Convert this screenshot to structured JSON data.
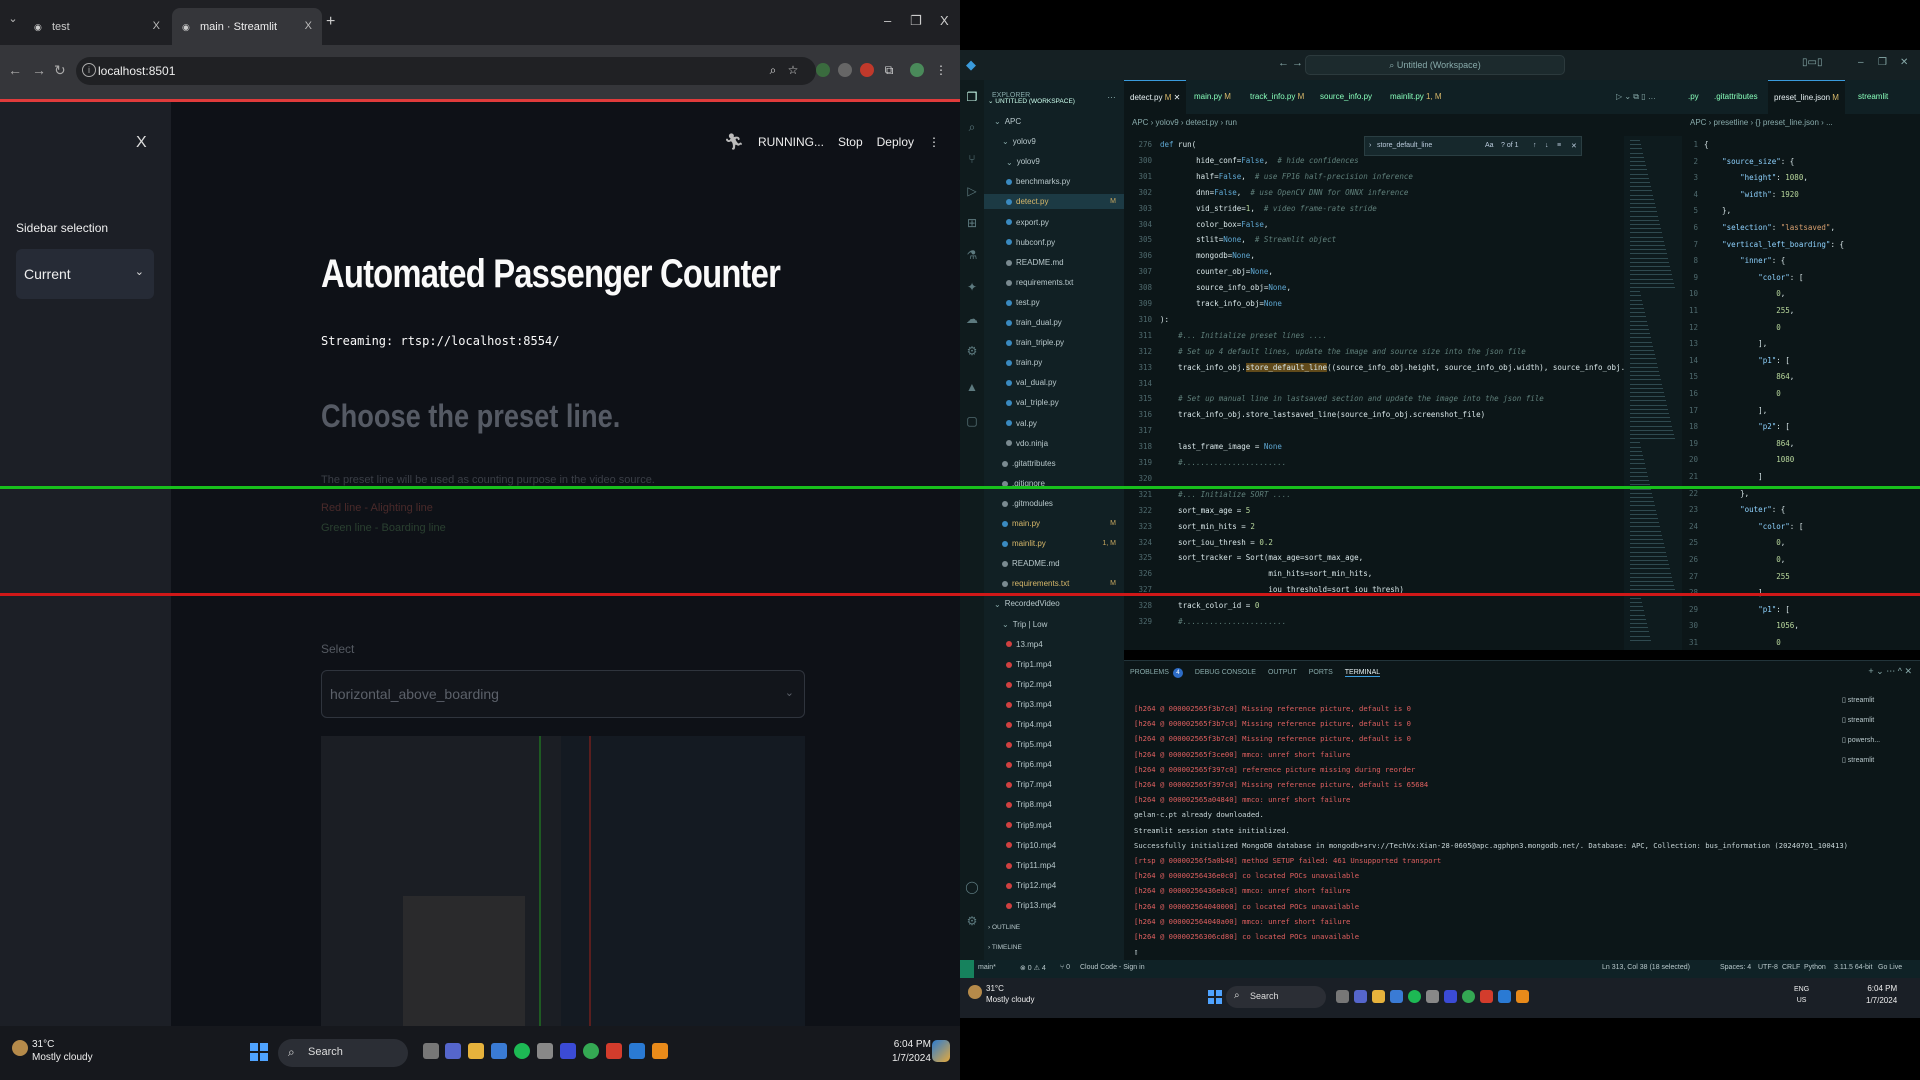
{
  "browser": {
    "tabs": [
      {
        "title": "test",
        "close": "X"
      },
      {
        "title": "main · Streamlit",
        "close": "X"
      }
    ],
    "new_tab": "+",
    "window_controls": {
      "minimize": "–",
      "restore": "❐",
      "close": "X"
    },
    "url": "localhost:8501"
  },
  "streamlit": {
    "sidebar": {
      "close": "X",
      "label": "Sidebar selection",
      "selected": "Current"
    },
    "header": {
      "status": "RUNNING...",
      "stop": "Stop",
      "deploy": "Deploy",
      "menu": "⋮"
    },
    "title": "Automated Passenger Counter",
    "streaming": "Streaming: rtsp://localhost:8554/",
    "subheader": "Choose the preset line.",
    "description": "The preset line will be used as counting purpose in the video source.",
    "red_line_text": "Red line - Alighting line",
    "green_line_text": "Green line - Boarding line",
    "select_label": "Select",
    "select_value": "horizontal_above_boarding"
  },
  "taskbar_left": {
    "temp": "31°C",
    "weather": "Mostly cloudy",
    "search": "Search",
    "time": "6:04 PM",
    "date": "1/7/2024"
  },
  "vscode": {
    "window_title": "Untitled (Workspace)",
    "explorer": {
      "header": "EXPLORER",
      "workspace": "UNTITLED (WORKSPACE)",
      "items": [
        {
          "name": "APC",
          "status": ""
        },
        {
          "name": "yolov9",
          "status": ""
        },
        {
          "name": "yolov9",
          "status": ""
        },
        {
          "name": "benchmarks.py",
          "status": ""
        },
        {
          "name": "detect.py",
          "status": "M"
        },
        {
          "name": "export.py",
          "status": ""
        },
        {
          "name": "hubconf.py",
          "status": ""
        },
        {
          "name": "README.md",
          "status": ""
        },
        {
          "name": "requirements.txt",
          "status": ""
        },
        {
          "name": "test.py",
          "status": ""
        },
        {
          "name": "train_dual.py",
          "status": ""
        },
        {
          "name": "train_triple.py",
          "status": ""
        },
        {
          "name": "train.py",
          "status": ""
        },
        {
          "name": "val_dual.py",
          "status": ""
        },
        {
          "name": "val_triple.py",
          "status": ""
        },
        {
          "name": "val.py",
          "status": ""
        },
        {
          "name": "vdo.ninja",
          "status": ""
        },
        {
          "name": ".gitattributes",
          "status": ""
        },
        {
          "name": ".gitignore",
          "status": ""
        },
        {
          "name": ".gitmodules",
          "status": ""
        },
        {
          "name": "main.py",
          "status": "M"
        },
        {
          "name": "mainlit.py",
          "status": "1, M"
        },
        {
          "name": "README.md",
          "status": ""
        },
        {
          "name": "requirements.txt",
          "status": "M"
        },
        {
          "name": "RecordedVideo",
          "status": ""
        },
        {
          "name": "Trip | Low",
          "status": ""
        },
        {
          "name": "13.mp4",
          "status": ""
        },
        {
          "name": "Trip1.mp4",
          "status": ""
        },
        {
          "name": "Trip2.mp4",
          "status": ""
        },
        {
          "name": "Trip3.mp4",
          "status": ""
        },
        {
          "name": "Trip4.mp4",
          "status": ""
        },
        {
          "name": "Trip5.mp4",
          "status": ""
        },
        {
          "name": "Trip6.mp4",
          "status": ""
        },
        {
          "name": "Trip7.mp4",
          "status": ""
        },
        {
          "name": "Trip8.mp4",
          "status": ""
        },
        {
          "name": "Trip9.mp4",
          "status": ""
        },
        {
          "name": "Trip10.mp4",
          "status": ""
        },
        {
          "name": "Trip11.mp4",
          "status": ""
        },
        {
          "name": "Trip12.mp4",
          "status": ""
        },
        {
          "name": "Trip13.mp4",
          "status": ""
        }
      ],
      "outline": "OUTLINE",
      "timeline": "TIMELINE"
    },
    "editor_tabs": [
      {
        "name": "detect.py",
        "mark": "M"
      },
      {
        "name": "main.py",
        "mark": "M"
      },
      {
        "name": "track_info.py",
        "mark": "M"
      },
      {
        "name": "source_info.py",
        "mark": ""
      },
      {
        "name": "mainlit.py",
        "mark": "1, M"
      }
    ],
    "breadcrumb": "APC › yolov9 › detect.py › run",
    "find": {
      "query": "store_default_line",
      "count": "? of 1"
    },
    "code_lines": [
      {
        "n": "276",
        "t": "def run("
      },
      {
        "n": "300",
        "t": "        hide_conf=False,  # hide confidences"
      },
      {
        "n": "301",
        "t": "        half=False,  # use FP16 half-precision inference"
      },
      {
        "n": "302",
        "t": "        dnn=False,  # use OpenCV DNN for ONNX inference"
      },
      {
        "n": "303",
        "t": "        vid_stride=1,  # video frame-rate stride"
      },
      {
        "n": "304",
        "t": "        color_box=False,"
      },
      {
        "n": "305",
        "t": "        stlit=None,  # Streamlit object"
      },
      {
        "n": "306",
        "t": "        mongodb=None,"
      },
      {
        "n": "307",
        "t": "        counter_obj=None,"
      },
      {
        "n": "308",
        "t": "        source_info_obj=None,"
      },
      {
        "n": "309",
        "t": "        track_info_obj=None"
      },
      {
        "n": "310",
        "t": "):"
      },
      {
        "n": "311",
        "t": "    #... Initialize preset lines ...."
      },
      {
        "n": "312",
        "t": "    # Set up 4 default lines, update the image and source size into the json file"
      },
      {
        "n": "313",
        "t": "    track_info_obj.store_default_line((source_info_obj.height, source_info_obj.width), source_info_obj.screenshot_file)"
      },
      {
        "n": "314",
        "t": ""
      },
      {
        "n": "315",
        "t": "    # Set up manual line in lastsaved section and update the image into the json file"
      },
      {
        "n": "316",
        "t": "    track_info_obj.store_lastsaved_line(source_info_obj.screenshot_file)"
      },
      {
        "n": "317",
        "t": ""
      },
      {
        "n": "318",
        "t": "    last_frame_image = None"
      },
      {
        "n": "319",
        "t": "    #......................."
      },
      {
        "n": "320",
        "t": ""
      },
      {
        "n": "321",
        "t": "    #... Initialize SORT ...."
      },
      {
        "n": "322",
        "t": "    sort_max_age = 5"
      },
      {
        "n": "323",
        "t": "    sort_min_hits = 2"
      },
      {
        "n": "324",
        "t": "    sort_iou_thresh = 0.2"
      },
      {
        "n": "325",
        "t": "    sort_tracker = Sort(max_age=sort_max_age,"
      },
      {
        "n": "326",
        "t": "                        min_hits=sort_min_hits,"
      },
      {
        "n": "327",
        "t": "                        iou_threshold=sort_iou_thresh)"
      },
      {
        "n": "328",
        "t": "    track_color_id = 0"
      },
      {
        "n": "329",
        "t": "    #......................."
      }
    ],
    "editor2_tabs": [
      {
        "name": ".py"
      },
      {
        "name": ".gitattributes"
      },
      {
        "name": "preset_line.json",
        "mark": "M"
      },
      {
        "name": "streamlit"
      }
    ],
    "editor2_breadcrumb": "APC › presetline › {} preset_line.json › ...",
    "json_lines": [
      {
        "n": "1",
        "t": "{"
      },
      {
        "n": "2",
        "t": "    \"source_size\": {"
      },
      {
        "n": "3",
        "t": "        \"height\": 1080,"
      },
      {
        "n": "4",
        "t": "        \"width\": 1920"
      },
      {
        "n": "5",
        "t": "    },"
      },
      {
        "n": "6",
        "t": "    \"selection\": \"lastsaved\","
      },
      {
        "n": "7",
        "t": "    \"vertical_left_boarding\": {"
      },
      {
        "n": "8",
        "t": "        \"inner\": {"
      },
      {
        "n": "9",
        "t": "            \"color\": ["
      },
      {
        "n": "10",
        "t": "                0,"
      },
      {
        "n": "11",
        "t": "                255,"
      },
      {
        "n": "12",
        "t": "                0"
      },
      {
        "n": "13",
        "t": "            ],"
      },
      {
        "n": "14",
        "t": "            \"p1\": ["
      },
      {
        "n": "15",
        "t": "                864,"
      },
      {
        "n": "16",
        "t": "                0"
      },
      {
        "n": "17",
        "t": "            ],"
      },
      {
        "n": "18",
        "t": "            \"p2\": ["
      },
      {
        "n": "19",
        "t": "                864,"
      },
      {
        "n": "20",
        "t": "                1080"
      },
      {
        "n": "21",
        "t": "            ]"
      },
      {
        "n": "22",
        "t": "        },"
      },
      {
        "n": "23",
        "t": "        \"outer\": {"
      },
      {
        "n": "24",
        "t": "            \"color\": ["
      },
      {
        "n": "25",
        "t": "                0,"
      },
      {
        "n": "26",
        "t": "                0,"
      },
      {
        "n": "27",
        "t": "                255"
      },
      {
        "n": "28",
        "t": "            ],"
      },
      {
        "n": "29",
        "t": "            \"p1\": ["
      },
      {
        "n": "30",
        "t": "                1056,"
      },
      {
        "n": "31",
        "t": "                0"
      }
    ],
    "panel": {
      "tabs": [
        "PROBLEMS",
        "DEBUG CONSOLE",
        "OUTPUT",
        "PORTS",
        "TERMINAL"
      ],
      "problems_count": "4",
      "terminals": [
        "streamlit",
        "streamlit",
        "powersh...",
        "streamlit"
      ],
      "terminal_lines": [
        {
          "c": "red",
          "t": "[h264 @ 000002565f3b7c0] Missing reference picture, default is 0"
        },
        {
          "c": "red",
          "t": "[h264 @ 000002565f3b7c0] Missing reference picture, default is 0"
        },
        {
          "c": "red",
          "t": "[h264 @ 000002565f3b7c0] Missing reference picture, default is 0"
        },
        {
          "c": "red",
          "t": "[h264 @ 000002565f3ce00] mmco: unref short failure"
        },
        {
          "c": "red",
          "t": "[h264 @ 000002565f397c0] reference picture missing during reorder"
        },
        {
          "c": "red",
          "t": "[h264 @ 000002565f397c0] Missing reference picture, default is 65684"
        },
        {
          "c": "red",
          "t": "[h264 @ 000002565a04840] mmco: unref short failure"
        },
        {
          "c": "def",
          "t": "gelan-c.pt already downloaded."
        },
        {
          "c": "def",
          "t": "Streamlit session state initialized."
        },
        {
          "c": "def",
          "t": "Successfully initialized MongoDB database in mongodb+srv://TechVx:Xian-28-0605@apc.agphpn3.mongodb.net/. Database: APC, Collection: bus_information (20240701_100413)"
        },
        {
          "c": "red",
          "t": "[rtsp @ 00000256f5a0b40] method SETUP failed: 461 Unsupported transport"
        },
        {
          "c": "red",
          "t": "[h264 @ 00000256436e0c0] co located POCs unavailable"
        },
        {
          "c": "red",
          "t": "[h264 @ 00000256436e0c0] mmco: unref short failure"
        },
        {
          "c": "red",
          "t": "[h264 @ 000002564040000] co located POCs unavailable"
        },
        {
          "c": "red",
          "t": "[h264 @ 000002564040a00] mmco: unref short failure"
        },
        {
          "c": "red",
          "t": "[h264 @ 00000256306cd80] co located POCs unavailable"
        },
        {
          "c": "def",
          "t": "▯"
        }
      ]
    },
    "statusbar": {
      "branch": "main*",
      "problems": "⊗ 0 ⚠ 4",
      "ports": "⑂ 0",
      "cloud": "Cloud Code - Sign in",
      "position": "Ln 313, Col 38 (18 selected)",
      "spaces": "Spaces: 4",
      "encoding": "UTF-8",
      "eol": "CRLF",
      "language": "Python",
      "interpreter": "3.11.5 64-bit",
      "golive": "Go Live"
    }
  },
  "taskbar_right": {
    "temp": "31°C",
    "weather": "Mostly cloudy",
    "search": "Search",
    "lang": "ENG",
    "region": "US",
    "time": "6:04 PM",
    "date": "1/7/2024"
  },
  "colors": {
    "green_line": "#18c01c",
    "red_line": "#d01818",
    "accent": "#3a9bdc"
  }
}
